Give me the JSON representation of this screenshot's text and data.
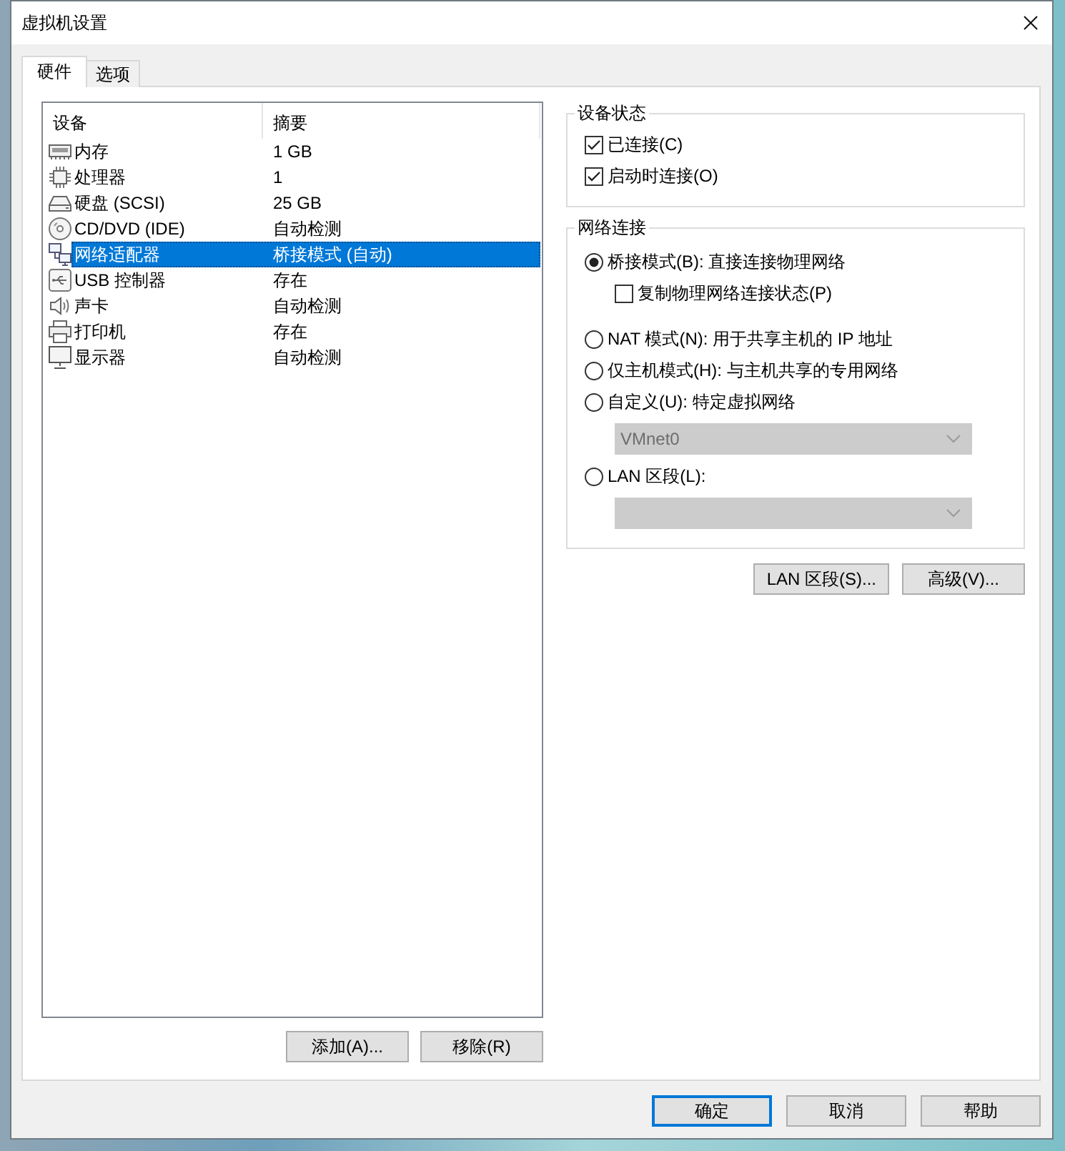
{
  "window": {
    "title": "虚拟机设置"
  },
  "tabs": [
    {
      "label": "硬件",
      "selected": true
    },
    {
      "label": "选项",
      "selected": false
    }
  ],
  "device_list": {
    "columns": [
      "设备",
      "摘要"
    ],
    "rows": [
      {
        "kind": "memory",
        "device": "内存",
        "summary": "1 GB",
        "selected": false
      },
      {
        "kind": "cpu",
        "device": "处理器",
        "summary": "1",
        "selected": false
      },
      {
        "kind": "disk",
        "device": "硬盘 (SCSI)",
        "summary": "25 GB",
        "selected": false
      },
      {
        "kind": "cdrom",
        "device": "CD/DVD (IDE)",
        "summary": "自动检测",
        "selected": false
      },
      {
        "kind": "network",
        "device": "网络适配器",
        "summary": "桥接模式 (自动)",
        "selected": true
      },
      {
        "kind": "usb",
        "device": "USB 控制器",
        "summary": "存在",
        "selected": false
      },
      {
        "kind": "sound",
        "device": "声卡",
        "summary": "自动检测",
        "selected": false
      },
      {
        "kind": "printer",
        "device": "打印机",
        "summary": "存在",
        "selected": false
      },
      {
        "kind": "display",
        "device": "显示器",
        "summary": "自动检测",
        "selected": false
      }
    ]
  },
  "list_buttons": [
    "添加(A)...",
    "移除(R)"
  ],
  "device_status": {
    "title": "设备状态",
    "options": [
      {
        "label": "已连接(C)",
        "checked": true
      },
      {
        "label": "启动时连接(O)",
        "checked": true
      }
    ]
  },
  "network_connection": {
    "title": "网络连接",
    "items": [
      {
        "kind": "radio",
        "label": "桥接模式(B): 直接连接物理网络",
        "selected": true
      },
      {
        "kind": "checkbox",
        "label": "复制物理网络连接状态(P)",
        "checked": false
      },
      {
        "kind": "radio",
        "label": "NAT 模式(N): 用于共享主机的 IP 地址",
        "selected": false
      },
      {
        "kind": "radio",
        "label": "仅主机模式(H): 与主机共享的专用网络",
        "selected": false
      },
      {
        "kind": "radio",
        "label": "自定义(U): 特定虚拟网络",
        "selected": false
      },
      {
        "kind": "dropdown",
        "value": "VMnet0",
        "disabled": true
      },
      {
        "kind": "radio",
        "label": "LAN 区段(L):",
        "selected": false
      },
      {
        "kind": "dropdown",
        "disabled": true
      }
    ]
  },
  "network_buttons": [
    "LAN 区段(S)...",
    "高级(V)..."
  ],
  "dialog_buttons": [
    {
      "label": "确定",
      "default": true
    },
    {
      "label": "取消",
      "default": false
    },
    {
      "label": "帮助",
      "default": false
    }
  ]
}
